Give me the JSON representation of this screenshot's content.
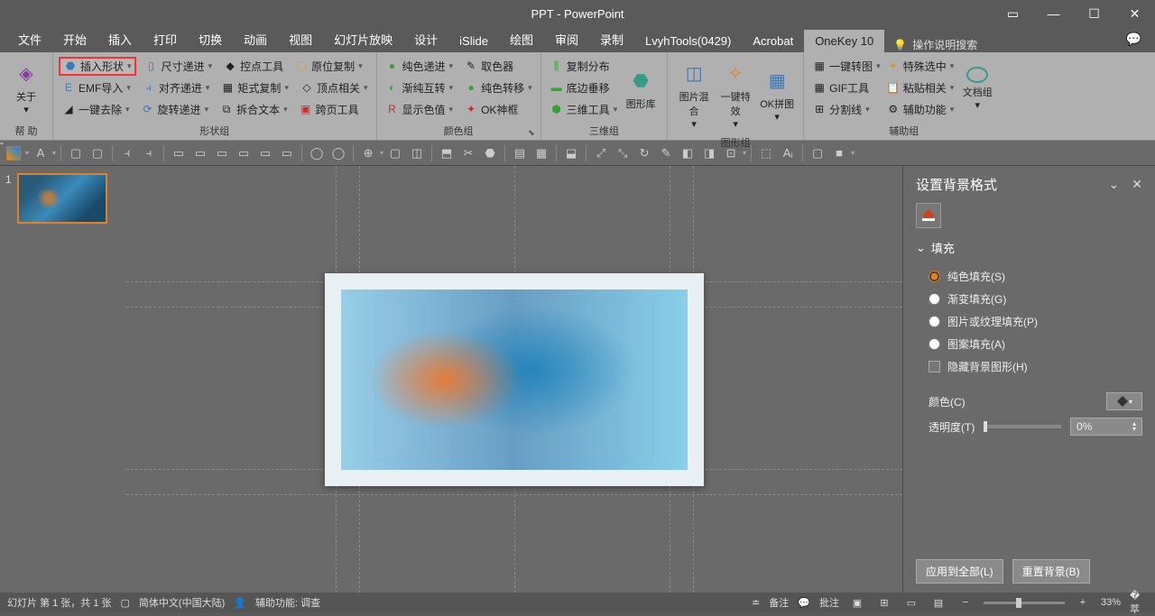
{
  "title": "PPT  -  PowerPoint",
  "tabs": [
    "文件",
    "开始",
    "插入",
    "打印",
    "切换",
    "动画",
    "视图",
    "幻灯片放映",
    "设计",
    "iSlide",
    "绘图",
    "审阅",
    "录制",
    "LvyhTools(0429)",
    "Acrobat",
    "OneKey 10"
  ],
  "active_tab": "OneKey 10",
  "search_placeholder": "操作说明搜索",
  "ribbon": {
    "help": {
      "about": "关于",
      "label": "帮 助"
    },
    "shape": {
      "c1": [
        "插入形状",
        "EMF导入",
        "一键去除"
      ],
      "c2": [
        "尺寸递进",
        "对齐递进",
        "旋转递进"
      ],
      "c3": [
        "控点工具",
        "矩式复制",
        "拆合文本"
      ],
      "c4": [
        "原位复制",
        "顶点相关",
        "跨页工具"
      ],
      "label": "形状组"
    },
    "color": {
      "c1": [
        "纯色递进",
        "渐纯互转",
        "显示色值"
      ],
      "c2": [
        "取色器",
        "纯色转移",
        "OK神框"
      ],
      "label": "颜色组"
    },
    "threeD": {
      "c1": [
        "复制分布",
        "底边垂移",
        "三维工具"
      ],
      "big": "图形库",
      "label": "三维组"
    },
    "graphic": {
      "big1": "图片混合",
      "big2": "一键特效",
      "big3": "OK拼图",
      "label": "图形组"
    },
    "aux": {
      "c1": [
        "一键转图",
        "GIF工具",
        "分割线"
      ],
      "c2": [
        "特殊选中",
        "粘贴相关",
        "辅助功能"
      ],
      "big": "文档组",
      "label": "辅助组"
    }
  },
  "thumb_num": "1",
  "panel": {
    "title": "设置背景格式",
    "section": "填充",
    "opts": [
      "纯色填充(S)",
      "渐变填充(G)",
      "图片或纹理填充(P)",
      "图案填充(A)"
    ],
    "hide": "隐藏背景图形(H)",
    "color_label": "颜色(C)",
    "trans_label": "透明度(T)",
    "trans_val": "0%",
    "apply": "应用到全部(L)",
    "reset": "重置背景(B)"
  },
  "status": {
    "slide": "幻灯片 第 1 张，共 1 张",
    "lang": "简体中文(中国大陆)",
    "access": "辅助功能: 调查",
    "notes": "备注",
    "comments": "批注",
    "zoom": "33%"
  }
}
